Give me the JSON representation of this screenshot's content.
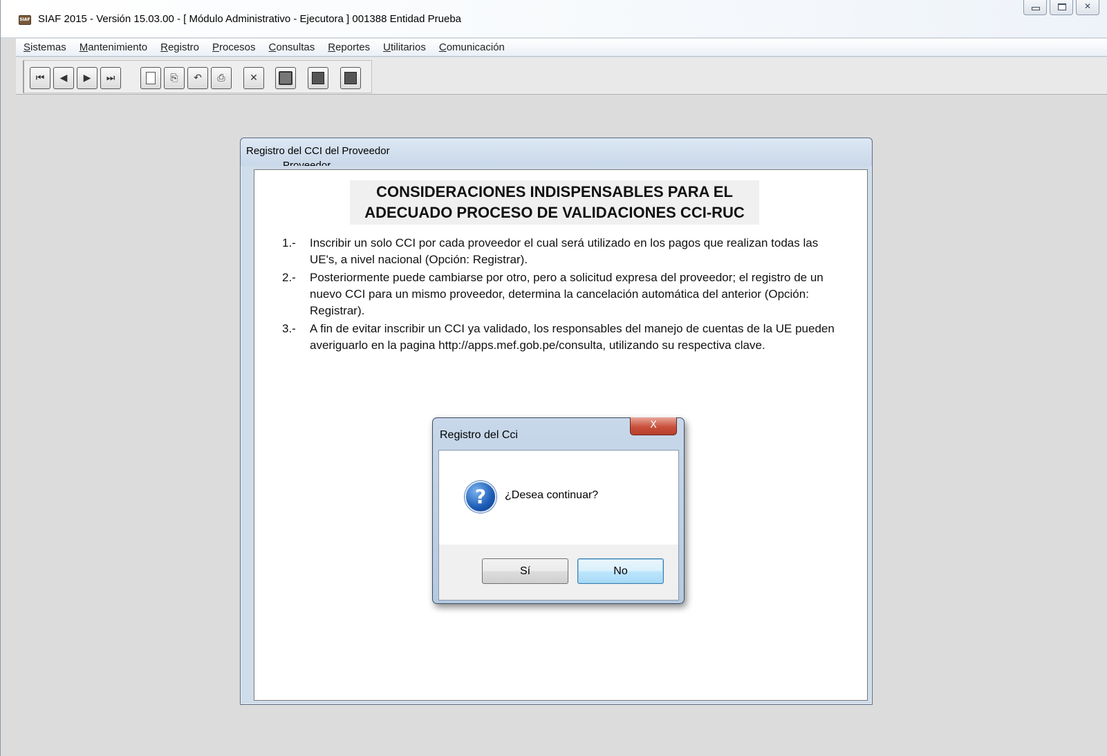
{
  "app": {
    "title": "SIAF 2015 - Versión 15.03.00 - [ Módulo Administrativo - Ejecutora ] 001388 Entidad Prueba",
    "icon": "siaf-app-icon",
    "icon_text": "SIAF"
  },
  "menu": [
    {
      "accel": "S",
      "rest": "istemas"
    },
    {
      "accel": "M",
      "rest": "antenimiento"
    },
    {
      "accel": "R",
      "rest": "egistro"
    },
    {
      "accel": "P",
      "rest": "rocesos"
    },
    {
      "accel": "C",
      "rest": "onsultas"
    },
    {
      "accel": "R",
      "rest": "eportes"
    },
    {
      "accel": "U",
      "rest": "tilitarios"
    },
    {
      "accel": "C",
      "rest": "omunicación"
    }
  ],
  "toolbar": {
    "first_glyph": "⏮",
    "prev_glyph": "◀",
    "next_glyph": "▶",
    "last_glyph": "⏭",
    "copy_glyph": "⎘",
    "undo_glyph": "↶",
    "print_glyph": "⎙",
    "delete_glyph": "✕"
  },
  "child_window": {
    "title": "Registro del CCI del Proveedor",
    "hidden_label": "Proveedor",
    "heading_line1": "CONSIDERACIONES INDISPENSABLES PARA EL",
    "heading_line2": "ADECUADO PROCESO DE VALIDACIONES CCI-RUC",
    "items": [
      {
        "num": "1.-",
        "text": "Inscribir un solo CCI por cada proveedor el cual será utilizado en los pagos que realizan todas las UE's, a nivel nacional (Opción: Registrar)."
      },
      {
        "num": "2.-",
        "text": "Posteriormente puede cambiarse por otro, pero a solicitud expresa del proveedor; el registro de un nuevo CCI para un mismo proveedor, determina la cancelación automática del anterior (Opción: Registrar)."
      },
      {
        "num": "3.-",
        "text": "A fin de evitar inscribir un CCI ya validado, los responsables del manejo de cuentas de la UE pueden averiguarlo en la pagina http://apps.mef.gob.pe/consulta, utilizando su respectiva clave."
      }
    ]
  },
  "dialog": {
    "title": "Registro del Cci",
    "close_glyph": "X",
    "icon": "question-icon",
    "icon_glyph": "?",
    "message": "¿Desea continuar?",
    "yes_label": "Sí",
    "no_label": "No"
  },
  "colors": {
    "desktop_bg": "#dcdcdc",
    "dialog_frame": "#b5c9df",
    "close_button": "#c9503b",
    "default_button_border": "#3c7fb1"
  }
}
